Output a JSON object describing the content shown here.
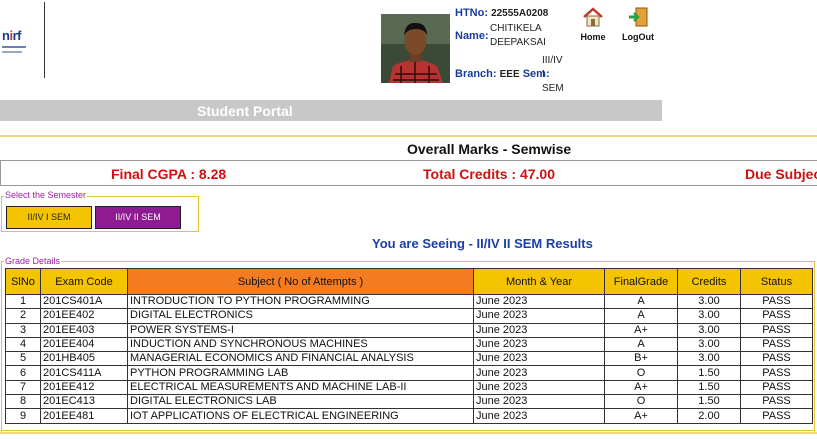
{
  "header": {
    "htno_label": "HTNo:",
    "htno_value": "22555A0208",
    "name_label": "Name:",
    "name_value": "CHITIKELA DEEPAKSAI",
    "branch_label": "Branch:",
    "branch_value": "EEE",
    "sem_label": "Sem:",
    "sem_value": "III/IV I SEM",
    "home_label": "Home",
    "logout_label": "LogOut"
  },
  "portal": {
    "title": "Student Portal"
  },
  "page": {
    "heading": "Overall Marks - Semwise"
  },
  "summary": {
    "cgpa": "Final CGPA : 8.28",
    "credits": "Total Credits : 47.00",
    "due": "Due Subjects"
  },
  "semester_select": {
    "legend": "Select the Semester",
    "buttons": [
      "II/IV I SEM",
      "II/IV II SEM"
    ]
  },
  "seeing": "You are Seeing - II/IV II SEM Results",
  "grades": {
    "legend": "Grade Details",
    "headers": [
      "SlNo",
      "Exam Code",
      "Subject ( No of Attempts )",
      "Month & Year",
      "FinalGrade",
      "Credits",
      "Status"
    ],
    "rows": [
      [
        "1",
        "201CS401A",
        "INTRODUCTION TO PYTHON PROGRAMMING",
        "June 2023",
        "A",
        "3.00",
        "PASS"
      ],
      [
        "2",
        "201EE402",
        "DIGITAL ELECTRONICS",
        "June 2023",
        "A",
        "3.00",
        "PASS"
      ],
      [
        "3",
        "201EE403",
        "POWER SYSTEMS-I",
        "June 2023",
        "A+",
        "3.00",
        "PASS"
      ],
      [
        "4",
        "201EE404",
        "INDUCTION AND SYNCHRONOUS MACHINES",
        "June 2023",
        "A",
        "3.00",
        "PASS"
      ],
      [
        "5",
        "201HB405",
        "MANAGERIAL ECONOMICS AND FINANCIAL ANALYSIS",
        "June 2023",
        "B+",
        "3.00",
        "PASS"
      ],
      [
        "6",
        "201CS411A",
        "PYTHON PROGRAMMING LAB",
        "June 2023",
        "O",
        "1.50",
        "PASS"
      ],
      [
        "7",
        "201EE412",
        "ELECTRICAL MEASUREMENTS AND MACHINE LAB-II",
        "June 2023",
        "A+",
        "1.50",
        "PASS"
      ],
      [
        "8",
        "201EC413",
        "DIGITAL ELECTRONICS LAB",
        "June 2023",
        "O",
        "1.50",
        "PASS"
      ],
      [
        "9",
        "201EE481",
        "IOT APPLICATIONS OF ELECTRICAL ENGINEERING",
        "June 2023",
        "A+",
        "2.00",
        "PASS"
      ]
    ]
  },
  "colors": {
    "accent_yellow": "#f5c400",
    "accent_orange": "#f37c22",
    "accent_purple": "#8e1b91",
    "label_blue": "#1a3c9c",
    "alert_red": "#d01010"
  },
  "icons": {
    "home": "home-icon",
    "logout": "logout-icon",
    "logo": "nirf-logo"
  }
}
